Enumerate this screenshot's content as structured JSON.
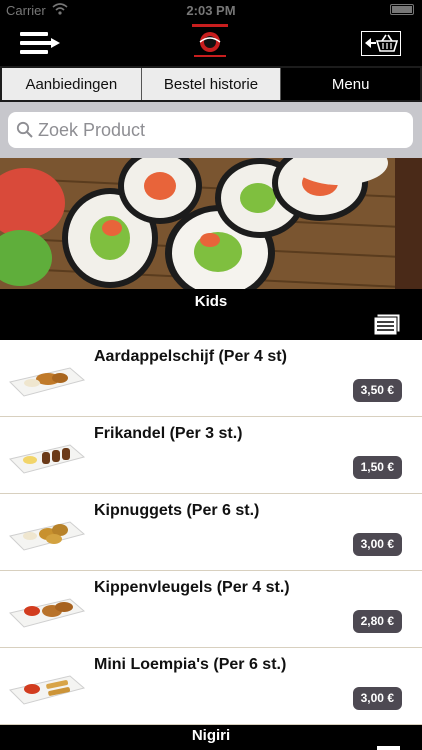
{
  "status_bar": {
    "carrier": "Carrier",
    "time": "2:03 PM"
  },
  "navbar": {
    "menu_icon": "menu-arrow-icon",
    "logo_icon": "restaurant-logo",
    "cart_icon": "basket-back-icon"
  },
  "tabs": [
    {
      "label": "Aanbiedingen",
      "active": false
    },
    {
      "label": "Bestel historie",
      "active": false
    },
    {
      "label": "Menu",
      "active": true
    }
  ],
  "search": {
    "placeholder": "Zoek Product",
    "value": ""
  },
  "banner": {
    "image": "sushi-rolls-photo"
  },
  "categories": [
    {
      "title": "Kids",
      "icon": "list-view-icon"
    },
    {
      "title": "Nigiri",
      "icon": "list-view-icon"
    }
  ],
  "products": [
    {
      "name": "Aardappelschijf (Per 4 st)",
      "price": "3,50 €"
    },
    {
      "name": "Frikandel (Per 3 st.)",
      "price": "1,50 €"
    },
    {
      "name": "Kipnuggets (Per 6 st.)",
      "price": "3,00 €"
    },
    {
      "name": "Kippenvleugels (Per 4 st.)",
      "price": "2,80 €"
    },
    {
      "name": "Mini Loempia's (Per 6 st.)",
      "price": "3,00 €"
    }
  ],
  "colors": {
    "price_badge": "#4d4952",
    "active_tab": "#000000",
    "search_bg": "#c7c7cc"
  }
}
